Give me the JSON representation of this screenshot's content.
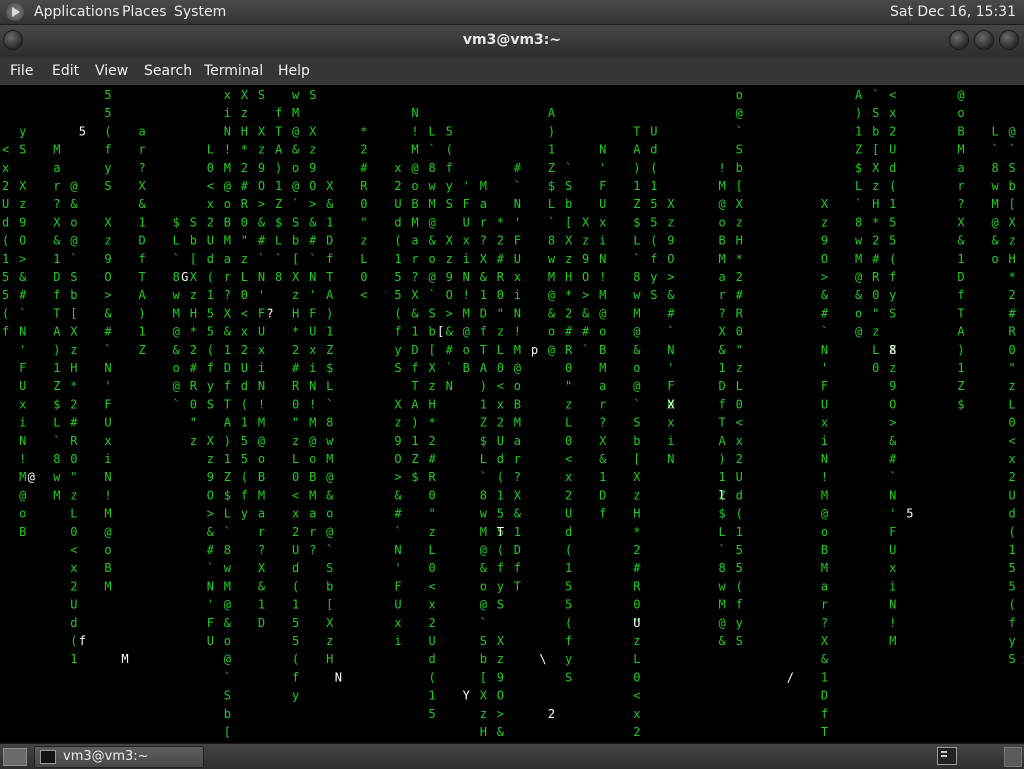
{
  "top_panel": {
    "menus": [
      "Applications",
      "Places",
      "System"
    ],
    "clock": "Sat Dec 16, 15:31"
  },
  "window": {
    "title": "vm3@vm3:~",
    "menubar": [
      "File",
      "Edit",
      "View",
      "Search",
      "Terminal",
      "Help"
    ]
  },
  "terminal": {
    "program_effect": "matrix digital rain",
    "text_color": "#22cc22",
    "highlight_color": "#ffffff",
    "background": "#000000",
    "columns": [
      "<x2Ud(15",
      "5(fyS X",
      "z9O",
      ">&#`N'",
      "FUxiN!",
      "M@oBMa",
      "r?X",
      "&1D",
      "fTA)1Z$",
      "L`8wM@",
      "&o@",
      "`Sb",
      "[X",
      "zH*2#R",
      "0",
      "\"zL0"
    ],
    "highlights": [
      "N",
      "l",
      "?",
      "f",
      "5",
      "G",
      "@",
      "[",
      "\\",
      "p",
      "M",
      "X",
      "5",
      "Y",
      "8",
      "T",
      "/",
      "2",
      "U"
    ]
  },
  "bottom_panel": {
    "task_label": "vm3@vm3:~"
  }
}
